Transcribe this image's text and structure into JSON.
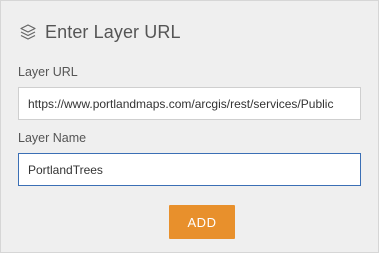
{
  "header": {
    "icon": "layers-icon",
    "title": "Enter Layer URL"
  },
  "form": {
    "url_label": "Layer URL",
    "url_value": "https://www.portlandmaps.com/arcgis/rest/services/Public",
    "name_label": "Layer Name",
    "name_value": "PortlandTrees",
    "add_label": "ADD"
  },
  "colors": {
    "panel_background": "#efefef",
    "add_button": "#e8902c",
    "focus_border": "#3b6fb5"
  }
}
